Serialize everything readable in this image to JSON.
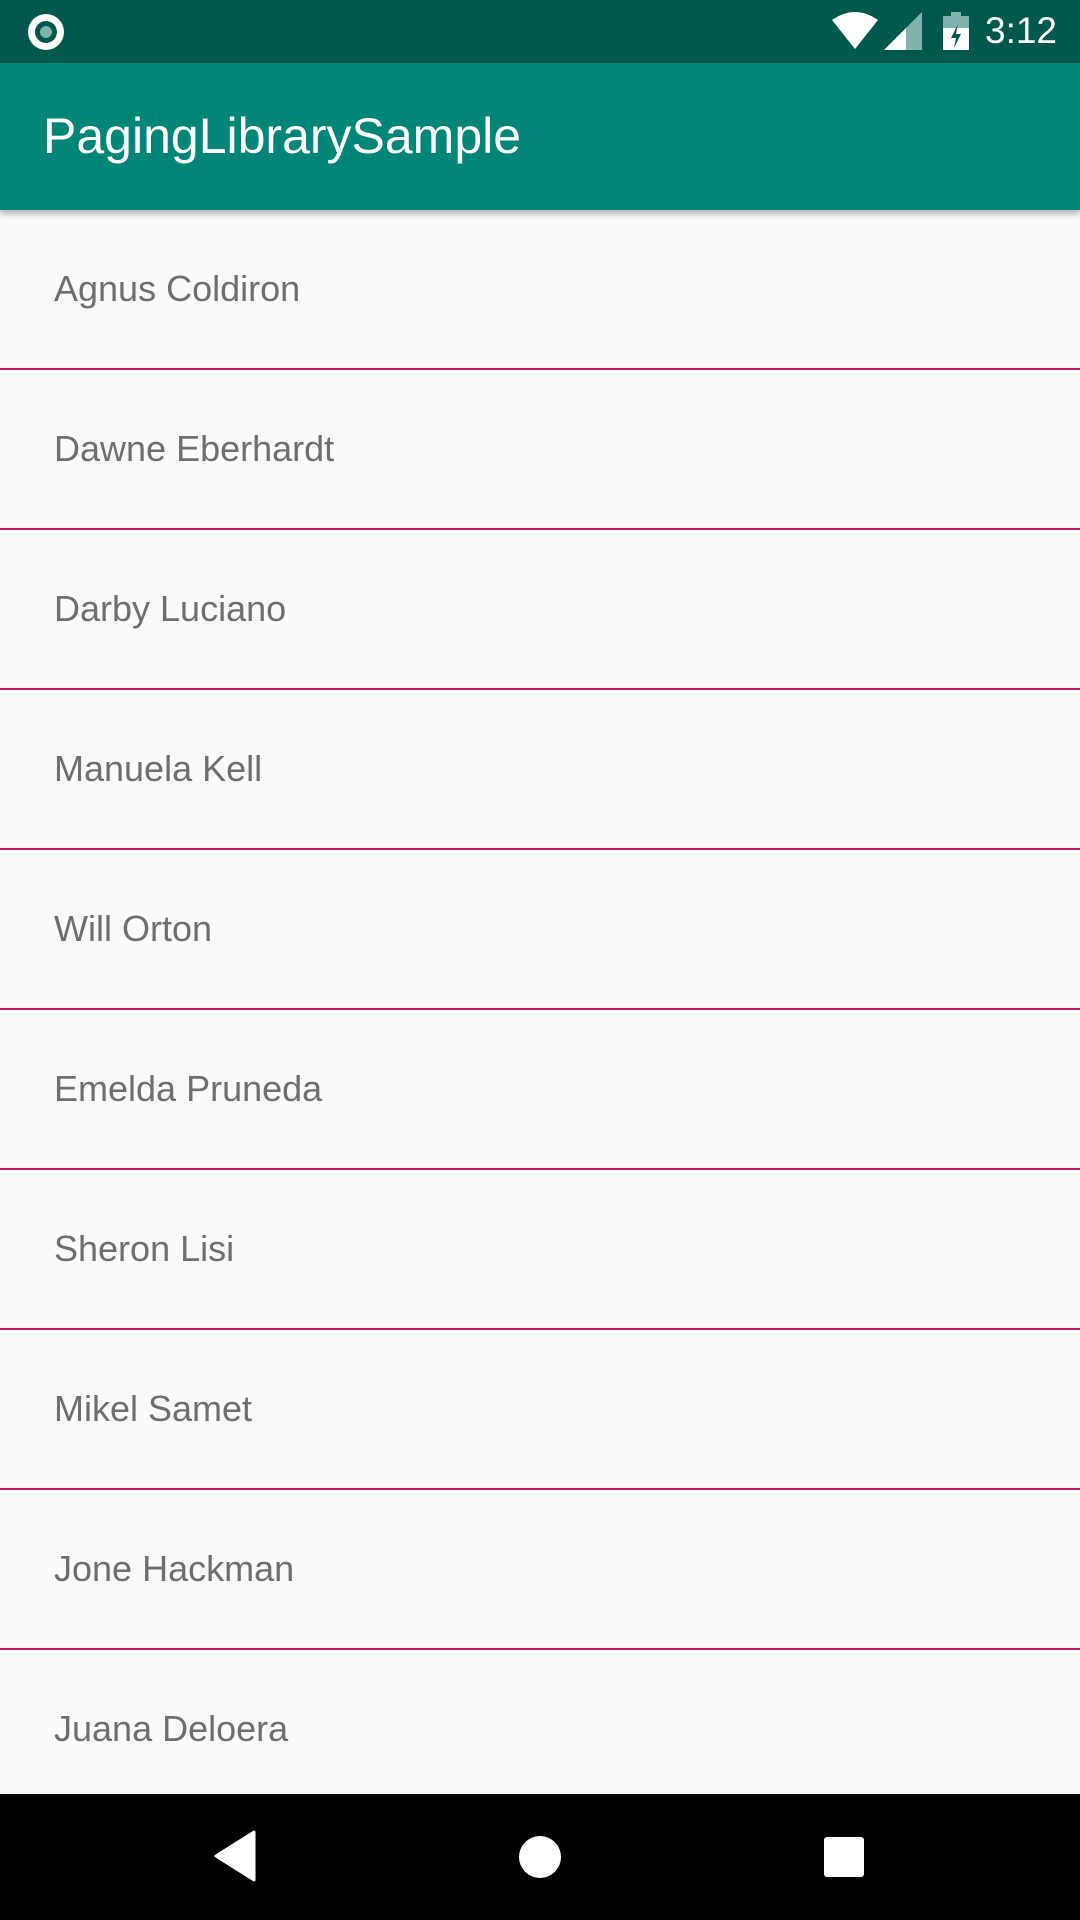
{
  "status_bar": {
    "time": "3:12",
    "icons": [
      "notification-circle-icon",
      "wifi-icon",
      "cell-signal-icon",
      "battery-charging-icon"
    ]
  },
  "app_bar": {
    "title": "PagingLibrarySample"
  },
  "list": {
    "items": [
      {
        "label": "Agnus Coldiron"
      },
      {
        "label": "Dawne Eberhardt"
      },
      {
        "label": "Darby Luciano"
      },
      {
        "label": "Manuela Kell"
      },
      {
        "label": "Will Orton"
      },
      {
        "label": "Emelda Pruneda"
      },
      {
        "label": "Sheron Lisi"
      },
      {
        "label": "Mikel Samet"
      },
      {
        "label": "Jone Hackman"
      },
      {
        "label": "Juana Deloera"
      }
    ]
  },
  "nav_bar": {
    "icons": [
      "back-icon",
      "home-icon",
      "recents-icon"
    ]
  },
  "colors": {
    "status_bar": "#00574b",
    "app_bar": "#008577",
    "divider": "#c2185b",
    "background": "#fafafa",
    "item_text": "#6e6e6e"
  }
}
